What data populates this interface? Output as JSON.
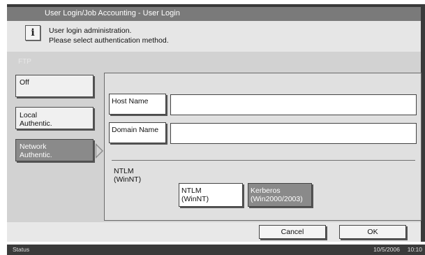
{
  "title": "User Login/Job Accounting - User Login",
  "message": {
    "line1": "User login administration.",
    "line2": "Please select authentication method."
  },
  "icons": {
    "info": "i"
  },
  "section_label": "FTP",
  "auth_methods": [
    {
      "label": "Off",
      "selected": false
    },
    {
      "label": "Local\nAuthentic.",
      "selected": false
    },
    {
      "label": "Network\nAuthentic.",
      "selected": true
    }
  ],
  "fields": {
    "host_name_label": "Host Name",
    "host_name_value": "",
    "domain_name_label": "Domain Name",
    "domain_name_value": ""
  },
  "server_type": {
    "current": "NTLM\n(WinNT)",
    "options": [
      {
        "label": "NTLM\n(WinNT)",
        "selected": false
      },
      {
        "label": "Kerberos\n(Win2000/2003)",
        "selected": true
      }
    ]
  },
  "buttons": {
    "cancel": "Cancel",
    "ok": "OK"
  },
  "status": {
    "label": "Status",
    "date": "10/5/2006",
    "time": "10:10"
  }
}
